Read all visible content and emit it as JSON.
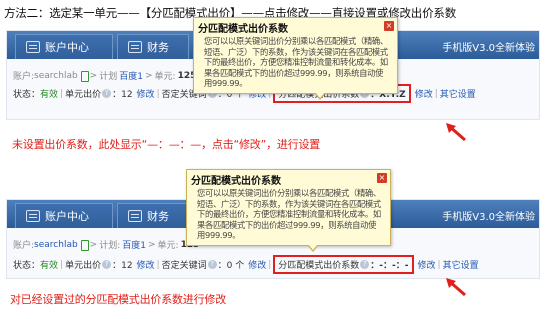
{
  "heading": "方法二：选定某一单元——【分匹配模式出价】——点击修改——直接设置或修改出价系数",
  "colors": {
    "accent_red": "#e0201a",
    "nav_blue": "#2b5b98",
    "link_blue": "#2357b5",
    "tooltip_bg": "#fffbd6"
  },
  "tooltip": {
    "title": "分匹配模式出价系数",
    "body": "您可以以原关键词出价分别乘以各匹配模式（精确、短语、广泛）下的系数，作为该关键词在各匹配模式下的最终出价，方便您精准控制流量和转化成本。如果各匹配模式下的出价超过999.99，则系统自动使用999.99。",
    "close_icon": "close-icon"
  },
  "panel1": {
    "nav": {
      "account": "账户中心",
      "finance": "财务"
    },
    "promo": "手机版V3.0全新体验",
    "breadcrumb": {
      "account_label": "账户:",
      "account": "searchlab",
      "sep1": ">",
      "plan_label": "计划",
      "plan": "百度1",
      "sep2": ">",
      "unit_label": "单元:",
      "unit": "125"
    },
    "status_row": {
      "status_label": "状态：",
      "status_value": "有效",
      "bid_label": "单元出价",
      "bid_value": "：12",
      "bid_edit": "修改",
      "neg_label": "否定关键词",
      "neg_value": "：0 个",
      "neg_edit": "修改",
      "coef_label": "分匹配模式出价系数",
      "coef_value": "：X:Y:Z",
      "coef_edit": "修改",
      "other": "其它设置"
    },
    "note": "未设置出价系数，此处显示“—：—：—，点击“修改”，进行设置"
  },
  "panel2": {
    "nav": {
      "account": "账户中心",
      "finance": "财务"
    },
    "promo": "手机版V3.0全新体验",
    "breadcrumb": {
      "account_label": "账户:",
      "account": "searchlab",
      "sep1": ">",
      "plan_label": "计划:",
      "plan": "百度1",
      "sep2": ">",
      "unit_label": "单元:",
      "unit": "125"
    },
    "status_row": {
      "status_label": "状态：",
      "status_value": "有效",
      "bid_label": "单元出价",
      "bid_value": "：12",
      "bid_edit": "修改",
      "neg_label": "否定关键词",
      "neg_value": "：0 个",
      "neg_edit": "修改",
      "coef_label": "分匹配模式出价系数",
      "coef_value": "：-：-：-",
      "coef_edit": "修改",
      "other": "其它设置"
    },
    "note": "对已经设置过的分匹配模式出价系数进行修改"
  }
}
